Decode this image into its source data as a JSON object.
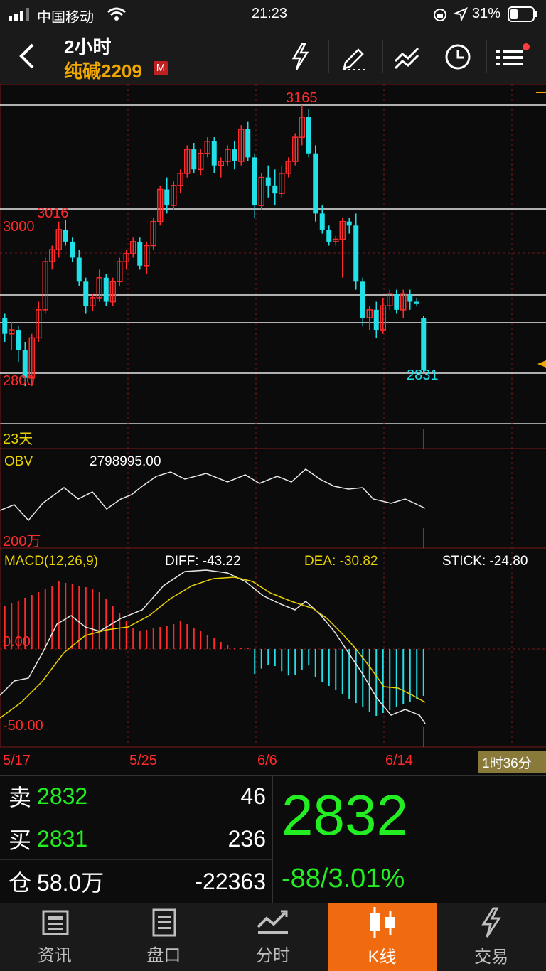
{
  "status_bar": {
    "carrier": "中国移动",
    "time": "21:23",
    "battery": "31%"
  },
  "header": {
    "period": "2小时",
    "symbol": "纯碱2209",
    "badge": "M"
  },
  "colors": {
    "up": "#ff2b2b",
    "down": "#22e0e8",
    "yellow": "#e8d200",
    "accent": "#f06a0f",
    "green": "#22ee22"
  },
  "price_chart": {
    "high_label": "3165",
    "low_label": "2831",
    "level_3016": "3016",
    "axis_3000": "3000",
    "axis_2800": "2800",
    "period_label": "23天"
  },
  "obv": {
    "title": "OBV",
    "value": "2798995.00",
    "axis_label": "200万"
  },
  "macd": {
    "title": "MACD(12,26,9)",
    "diff": "DIFF: -43.22",
    "dea": "DEA: -30.82",
    "stick": "STICK: -24.80",
    "zero_label": "0.00",
    "low_label": "-50.00"
  },
  "dates": [
    "5/17",
    "5/25",
    "6/6",
    "6/14"
  ],
  "time_remaining": "1时36分",
  "quote": {
    "sell_label": "卖",
    "sell_price": "2832",
    "sell_vol": "46",
    "buy_label": "买",
    "buy_price": "2831",
    "buy_vol": "236",
    "oi_label": "仓",
    "oi_value": "58.0万",
    "oi_change": "-22363",
    "last_price": "2832",
    "change": "-88/3.01%"
  },
  "nav": [
    {
      "label": "资讯",
      "icon": "news-icon"
    },
    {
      "label": "盘口",
      "icon": "orderbook-icon"
    },
    {
      "label": "分时",
      "icon": "timeshare-icon"
    },
    {
      "label": "K线",
      "icon": "candlestick-icon"
    },
    {
      "label": "交易",
      "icon": "lightning-icon"
    }
  ],
  "chart_data": {
    "type": "candlestick",
    "price_levels": [
      3165,
      3016,
      3000,
      2800,
      2831
    ],
    "candles": [
      [
        2900,
        2905,
        2870,
        2880
      ],
      [
        2880,
        2895,
        2860,
        2885
      ],
      [
        2885,
        2890,
        2845,
        2860
      ],
      [
        2860,
        2870,
        2815,
        2825
      ],
      [
        2825,
        2880,
        2815,
        2875
      ],
      [
        2875,
        2920,
        2870,
        2910
      ],
      [
        2910,
        2975,
        2905,
        2970
      ],
      [
        2970,
        2990,
        2960,
        2985
      ],
      [
        2985,
        3020,
        2975,
        3010
      ],
      [
        3010,
        3022,
        2990,
        2995
      ],
      [
        2995,
        3000,
        2970,
        2975
      ],
      [
        2975,
        2985,
        2940,
        2945
      ],
      [
        2945,
        2950,
        2905,
        2915
      ],
      [
        2915,
        2930,
        2908,
        2925
      ],
      [
        2925,
        2960,
        2920,
        2950
      ],
      [
        2950,
        2955,
        2915,
        2920
      ],
      [
        2920,
        2950,
        2915,
        2945
      ],
      [
        2945,
        2975,
        2940,
        2970
      ],
      [
        2970,
        2985,
        2960,
        2980
      ],
      [
        2980,
        3000,
        2975,
        2995
      ],
      [
        2995,
        3000,
        2960,
        2965
      ],
      [
        2965,
        2995,
        2955,
        2990
      ],
      [
        2990,
        3025,
        2985,
        3020
      ],
      [
        3020,
        3065,
        3015,
        3060
      ],
      [
        3060,
        3075,
        3030,
        3040
      ],
      [
        3040,
        3070,
        3035,
        3065
      ],
      [
        3065,
        3085,
        3055,
        3080
      ],
      [
        3080,
        3115,
        3075,
        3110
      ],
      [
        3110,
        3118,
        3080,
        3085
      ],
      [
        3085,
        3110,
        3078,
        3105
      ],
      [
        3105,
        3125,
        3100,
        3120
      ],
      [
        3120,
        3125,
        3080,
        3090
      ],
      [
        3090,
        3100,
        3075,
        3095
      ],
      [
        3095,
        3115,
        3090,
        3110
      ],
      [
        3110,
        3120,
        3085,
        3095
      ],
      [
        3095,
        3140,
        3090,
        3135
      ],
      [
        3135,
        3145,
        3095,
        3100
      ],
      [
        3100,
        3105,
        3025,
        3040
      ],
      [
        3040,
        3080,
        3035,
        3075
      ],
      [
        3075,
        3090,
        3050,
        3065
      ],
      [
        3065,
        3085,
        3040,
        3055
      ],
      [
        3055,
        3090,
        3050,
        3080
      ],
      [
        3080,
        3100,
        3075,
        3095
      ],
      [
        3095,
        3130,
        3090,
        3125
      ],
      [
        3125,
        3165,
        3115,
        3150
      ],
      [
        3150,
        3160,
        3100,
        3105
      ],
      [
        3105,
        3115,
        3020,
        3030
      ],
      [
        3030,
        3040,
        3005,
        3010
      ],
      [
        3010,
        3015,
        2990,
        2995
      ],
      [
        2995,
        3002,
        2990,
        2998
      ],
      [
        2998,
        3025,
        2950,
        3020
      ],
      [
        3020,
        3025,
        3005,
        3015
      ],
      [
        3015,
        3030,
        2935,
        2945
      ],
      [
        2945,
        2950,
        2890,
        2900
      ],
      [
        2900,
        2915,
        2885,
        2910
      ],
      [
        2910,
        2920,
        2875,
        2885
      ],
      [
        2885,
        2925,
        2880,
        2915
      ],
      [
        2915,
        2935,
        2910,
        2930
      ],
      [
        2930,
        2935,
        2905,
        2910
      ],
      [
        2910,
        2935,
        2900,
        2930
      ],
      [
        2930,
        2935,
        2910,
        2920
      ],
      [
        2920,
        2925,
        2915,
        2918
      ],
      [
        2900,
        2902,
        2831,
        2835
      ]
    ]
  }
}
